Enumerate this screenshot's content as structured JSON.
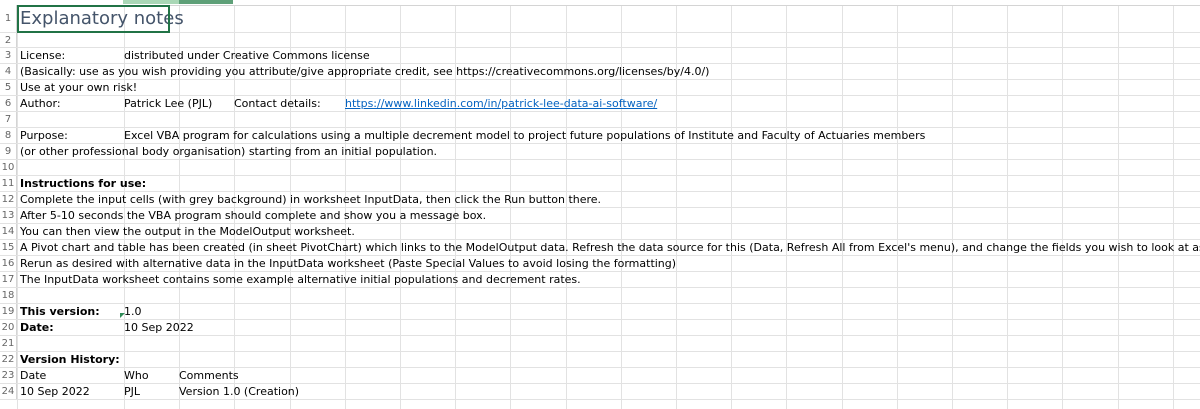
{
  "rows": [
    {
      "num": "1",
      "cells": [
        {
          "text": "Explanatory notes",
          "style": "title"
        }
      ]
    },
    {
      "num": "2",
      "cells": []
    },
    {
      "num": "3",
      "cells": [
        {
          "text": "License:",
          "col": "A"
        },
        {
          "text": "distributed under Creative Commons license",
          "col": "B"
        }
      ]
    },
    {
      "num": "4",
      "cells": [
        {
          "text": "(Basically: use as you wish providing you attribute/give appropriate credit, see https://creativecommons.org/licenses/by/4.0/)",
          "col": "A"
        }
      ]
    },
    {
      "num": "5",
      "cells": [
        {
          "text": "Use at your own risk!",
          "col": "A"
        }
      ]
    },
    {
      "num": "6",
      "cells": [
        {
          "text": "Author:",
          "col": "A"
        },
        {
          "text": "Patrick Lee (PJL)",
          "col": "B"
        },
        {
          "text": "Contact details:",
          "col": "D"
        },
        {
          "text": "https://www.linkedin.com/in/patrick-lee-data-ai-software/",
          "col": "F",
          "style": "link"
        }
      ]
    },
    {
      "num": "7",
      "cells": []
    },
    {
      "num": "8",
      "cells": [
        {
          "text": "Purpose:",
          "col": "A"
        },
        {
          "text": "Excel VBA program for calculations using a multiple decrement model to project future populations of Institute and Faculty of Actuaries members",
          "col": "B"
        }
      ]
    },
    {
      "num": "9",
      "cells": [
        {
          "text": "(or other professional body organisation) starting from an initial population.",
          "col": "A"
        }
      ]
    },
    {
      "num": "10",
      "cells": []
    },
    {
      "num": "11",
      "cells": [
        {
          "text": "Instructions for use:",
          "col": "A",
          "style": "bold"
        }
      ]
    },
    {
      "num": "12",
      "cells": [
        {
          "text": "Complete the input cells (with grey background) in worksheet InputData, then click the Run button there.",
          "col": "A"
        }
      ]
    },
    {
      "num": "13",
      "cells": [
        {
          "text": "After 5-10 seconds the VBA program should complete and show you a message box.",
          "col": "A"
        }
      ]
    },
    {
      "num": "14",
      "cells": [
        {
          "text": "You can then view the output in the ModelOutput worksheet.",
          "col": "A"
        }
      ]
    },
    {
      "num": "15",
      "cells": [
        {
          "text": "A Pivot chart and table has been created (in sheet PivotChart) which links to the ModelOutput data. Refresh the data source for this (Data, Refresh All from Excel's menu), and change the fields you wish to look at  as desired.",
          "col": "A"
        }
      ]
    },
    {
      "num": "16",
      "cells": [
        {
          "text": "Rerun as desired with alternative data in the InputData worksheet (Paste Special Values to avoid losing the formatting)",
          "col": "A"
        }
      ]
    },
    {
      "num": "17",
      "cells": [
        {
          "text": "The InputData worksheet contains some example alternative initial populations and decrement rates.",
          "col": "A"
        }
      ]
    },
    {
      "num": "18",
      "cells": []
    },
    {
      "num": "19",
      "cells": [
        {
          "text": "This version:",
          "col": "A",
          "style": "bold"
        },
        {
          "text": "1.0",
          "col": "B"
        }
      ]
    },
    {
      "num": "20",
      "cells": [
        {
          "text": "Date:",
          "col": "A",
          "style": "bold"
        },
        {
          "text": "10 Sep 2022",
          "col": "B"
        }
      ]
    },
    {
      "num": "21",
      "cells": []
    },
    {
      "num": "22",
      "cells": [
        {
          "text": "Version History:",
          "col": "A",
          "style": "bold"
        }
      ]
    },
    {
      "num": "23",
      "cells": [
        {
          "text": "Date",
          "col": "A"
        },
        {
          "text": "Who",
          "col": "B"
        },
        {
          "text": "Comments",
          "col": "C"
        }
      ]
    },
    {
      "num": "24",
      "cells": [
        {
          "text": "10 Sep 2022",
          "col": "A"
        },
        {
          "text": "PJL",
          "col": "B"
        },
        {
          "text": "Version 1.0 (Creation)",
          "col": "C"
        }
      ]
    }
  ],
  "colors": {
    "gridline": "#e2e2e2",
    "selection": "#217346",
    "link": "#0563c1",
    "title": "#44546a"
  }
}
